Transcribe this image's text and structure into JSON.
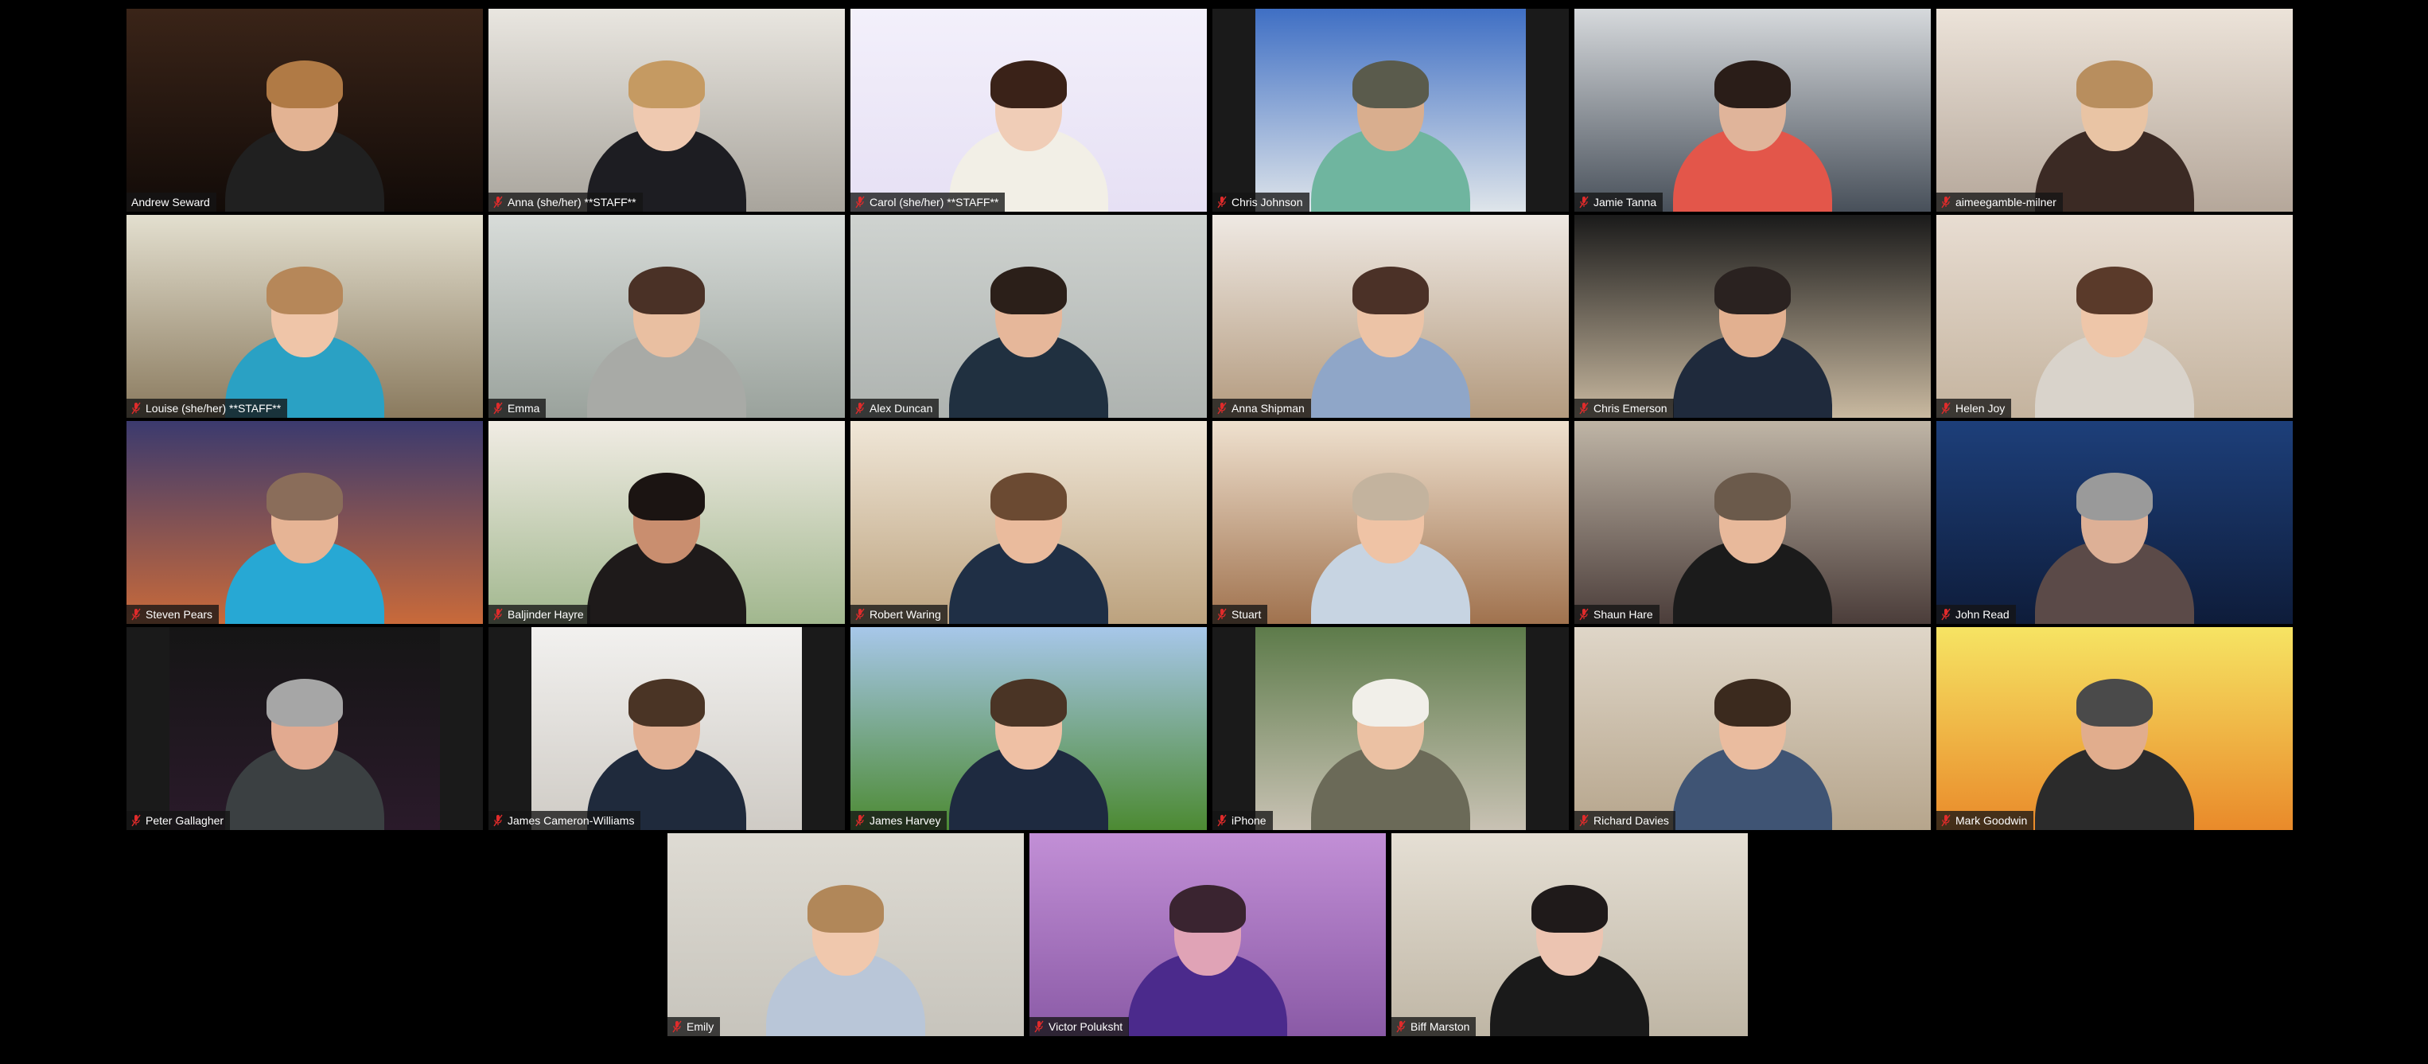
{
  "app": "Video conference gallery view",
  "colors": {
    "background": "#000000",
    "tile_placeholder": "#1a1a1a",
    "active_speaker_border": "#d6ef8a",
    "muted_icon": "#e02b2b",
    "label_text": "#ffffff"
  },
  "active_speaker": "Carol (she/her) **STAFF**",
  "participants": [
    {
      "name": "Andrew Seward",
      "muted": false,
      "icon": "none",
      "bg": [
        "#3a2418",
        "#120b08"
      ],
      "skin": "#e3b393",
      "hair": "#b07a45",
      "shirt": "#202020",
      "layout": "full"
    },
    {
      "name": "Anna (she/her) **STAFF**",
      "muted": true,
      "icon": "mic-muted-icon",
      "bg": [
        "#e9e6e0",
        "#a8a49c"
      ],
      "skin": "#efc9b0",
      "hair": "#c59a62",
      "shirt": "#1d1d22",
      "layout": "full"
    },
    {
      "name": "Carol (she/her) **STAFF**",
      "muted": true,
      "icon": "mic-muted-icon",
      "bg": [
        "#f3f0fb",
        "#e6e0f4"
      ],
      "skin": "#f0cdb7",
      "hair": "#3a2218",
      "shirt": "#f2efe6",
      "layout": "full",
      "active": true
    },
    {
      "name": "Chris Johnson",
      "muted": true,
      "icon": "mic-muted-icon",
      "bg": [
        "#3f6fc4",
        "#dfe5ea"
      ],
      "skin": "#d9ae8e",
      "hair": "#5a5b4c",
      "shirt": "#6fb59f",
      "layout": "pillar"
    },
    {
      "name": "Jamie Tanna",
      "muted": true,
      "icon": "mic-muted-icon",
      "bg": [
        "#d6d9dc",
        "#48505a"
      ],
      "skin": "#e0b49a",
      "hair": "#2a1d18",
      "shirt": "#e3564a",
      "layout": "full"
    },
    {
      "name": "aimeegamble-milner",
      "muted": true,
      "icon": "mic-muted-icon",
      "bg": [
        "#ece3d9",
        "#b5a79a"
      ],
      "skin": "#e9c4a4",
      "hair": "#b88e5e",
      "shirt": "#3b2a24",
      "layout": "full"
    },
    {
      "name": "Louise (she/her) **STAFF**",
      "muted": true,
      "icon": "mic-muted-icon",
      "bg": [
        "#e3dfcf",
        "#8a7a5e"
      ],
      "skin": "#efc5a8",
      "hair": "#b68759",
      "shirt": "#2aa1c4",
      "layout": "full"
    },
    {
      "name": "Emma",
      "muted": true,
      "icon": "mic-muted-icon",
      "bg": [
        "#d8dcd9",
        "#9aa29c"
      ],
      "skin": "#e9bfa1",
      "hair": "#4a3126",
      "shirt": "#a8aaa6",
      "layout": "full"
    },
    {
      "name": "Alex Duncan",
      "muted": true,
      "icon": "mic-muted-icon",
      "bg": [
        "#cfd3d0",
        "#aeb3b0"
      ],
      "skin": "#e6b79a",
      "hair": "#2b1f19",
      "shirt": "#203040",
      "layout": "full"
    },
    {
      "name": "Anna Shipman",
      "muted": true,
      "icon": "mic-muted-icon",
      "bg": [
        "#efe9e3",
        "#b39a7e"
      ],
      "skin": "#ecc3a6",
      "hair": "#4b3127",
      "shirt": "#8fa6c8",
      "layout": "full"
    },
    {
      "name": "Chris Emerson",
      "muted": true,
      "icon": "mic-muted-icon",
      "bg": [
        "#1a1a1a",
        "#c9b9a0"
      ],
      "skin": "#e2b090",
      "hair": "#2a2220",
      "shirt": "#1f2a3c",
      "layout": "full"
    },
    {
      "name": "Helen Joy",
      "muted": true,
      "icon": "mic-muted-icon",
      "bg": [
        "#e8ddd2",
        "#c4b39e"
      ],
      "skin": "#eec6a9",
      "hair": "#5a3a2a",
      "shirt": "#d9d3cb",
      "layout": "full"
    },
    {
      "name": "Steven Pears",
      "muted": true,
      "icon": "mic-muted-icon",
      "bg": [
        "#3b3a6e",
        "#c96a3a"
      ],
      "skin": "#e6b495",
      "hair": "#8a6d5a",
      "shirt": "#27a8d4",
      "layout": "full"
    },
    {
      "name": "Baljinder Hayre",
      "muted": true,
      "icon": "mic-muted-icon",
      "bg": [
        "#f1ece4",
        "#a1b78e"
      ],
      "skin": "#c98e6f",
      "hair": "#1b1412",
      "shirt": "#1e1a1a",
      "layout": "full"
    },
    {
      "name": "Robert Waring",
      "muted": true,
      "icon": "mic-muted-icon",
      "bg": [
        "#f0e7d8",
        "#bca27e"
      ],
      "skin": "#eabb9d",
      "hair": "#6b4a32",
      "shirt": "#1f2f45",
      "layout": "full"
    },
    {
      "name": "Stuart",
      "muted": true,
      "icon": "mic-muted-icon",
      "bg": [
        "#efe1cf",
        "#a0724e"
      ],
      "skin": "#efc3a5",
      "hair": "#c3b39e",
      "shirt": "#c7d4e2",
      "layout": "full"
    },
    {
      "name": "Shaun Hare",
      "muted": true,
      "icon": "mic-muted-icon",
      "bg": [
        "#bfb5a6",
        "#4b3d3a"
      ],
      "skin": "#e8b99b",
      "hair": "#6b5a4b",
      "shirt": "#1b1b1b",
      "layout": "full"
    },
    {
      "name": "John Read",
      "muted": true,
      "icon": "mic-muted-icon",
      "bg": [
        "#1d3f7a",
        "#0e1c3a"
      ],
      "skin": "#ddb096",
      "hair": "#9a9a9a",
      "shirt": "#5b4a48",
      "layout": "full"
    },
    {
      "name": "Peter Gallagher",
      "muted": true,
      "icon": "mic-muted-icon",
      "bg": [
        "#151515",
        "#2a1a2a"
      ],
      "skin": "#e2aa90",
      "hair": "#a6a6a6",
      "shirt": "#3b4042",
      "layout": "pillar"
    },
    {
      "name": "James Cameron-Williams",
      "muted": true,
      "icon": "mic-muted-icon",
      "bg": [
        "#f2f1ef",
        "#cfcbc5"
      ],
      "skin": "#e3b194",
      "hair": "#4a3425",
      "shirt": "#1f2a3c",
      "layout": "pillar"
    },
    {
      "name": "James Harvey",
      "muted": true,
      "icon": "mic-muted-icon",
      "bg": [
        "#a7c7ea",
        "#4c8a32"
      ],
      "skin": "#efc0a4",
      "hair": "#4a3425",
      "shirt": "#1e2a40",
      "layout": "full"
    },
    {
      "name": "iPhone",
      "muted": true,
      "icon": "mic-muted-icon",
      "bg": [
        "#5d7b4a",
        "#c9c2b4"
      ],
      "skin": "#ebc1a3",
      "hair": "#f1efe9",
      "shirt": "#6b6a58",
      "layout": "pillar"
    },
    {
      "name": "Richard Davies",
      "muted": true,
      "icon": "mic-muted-icon",
      "bg": [
        "#dfd6c8",
        "#b6a58c"
      ],
      "skin": "#eabc9f",
      "hair": "#3b2a1e",
      "shirt": "#3f5474",
      "layout": "full"
    },
    {
      "name": "Mark Goodwin",
      "muted": true,
      "icon": "mic-muted-icon",
      "bg": [
        "#f6e463",
        "#e98a2a"
      ],
      "skin": "#e1ad8d",
      "hair": "#4a4a4a",
      "shirt": "#2b2b2b",
      "layout": "full"
    },
    {
      "name": "Emily",
      "muted": true,
      "icon": "mic-muted-icon",
      "bg": [
        "#dedbd3",
        "#c7c4bc"
      ],
      "skin": "#f0c8ad",
      "hair": "#b18759",
      "shirt": "#b9c6d8",
      "layout": "full"
    },
    {
      "name": "Victor Poluksht",
      "muted": true,
      "icon": "mic-muted-icon",
      "bg": [
        "#c28fd6",
        "#8a5aa6"
      ],
      "skin": "#e0a3b6",
      "hair": "#3a2430",
      "shirt": "#4b2a8c",
      "layout": "full"
    },
    {
      "name": "Biff Marston",
      "muted": true,
      "icon": "mic-muted-icon",
      "bg": [
        "#e5dfd4",
        "#bfb6a5"
      ],
      "skin": "#ecc4b1",
      "hair": "#1f1a1a",
      "shirt": "#1a1a1a",
      "layout": "full"
    }
  ],
  "rows": [
    6,
    6,
    6,
    6,
    3
  ]
}
